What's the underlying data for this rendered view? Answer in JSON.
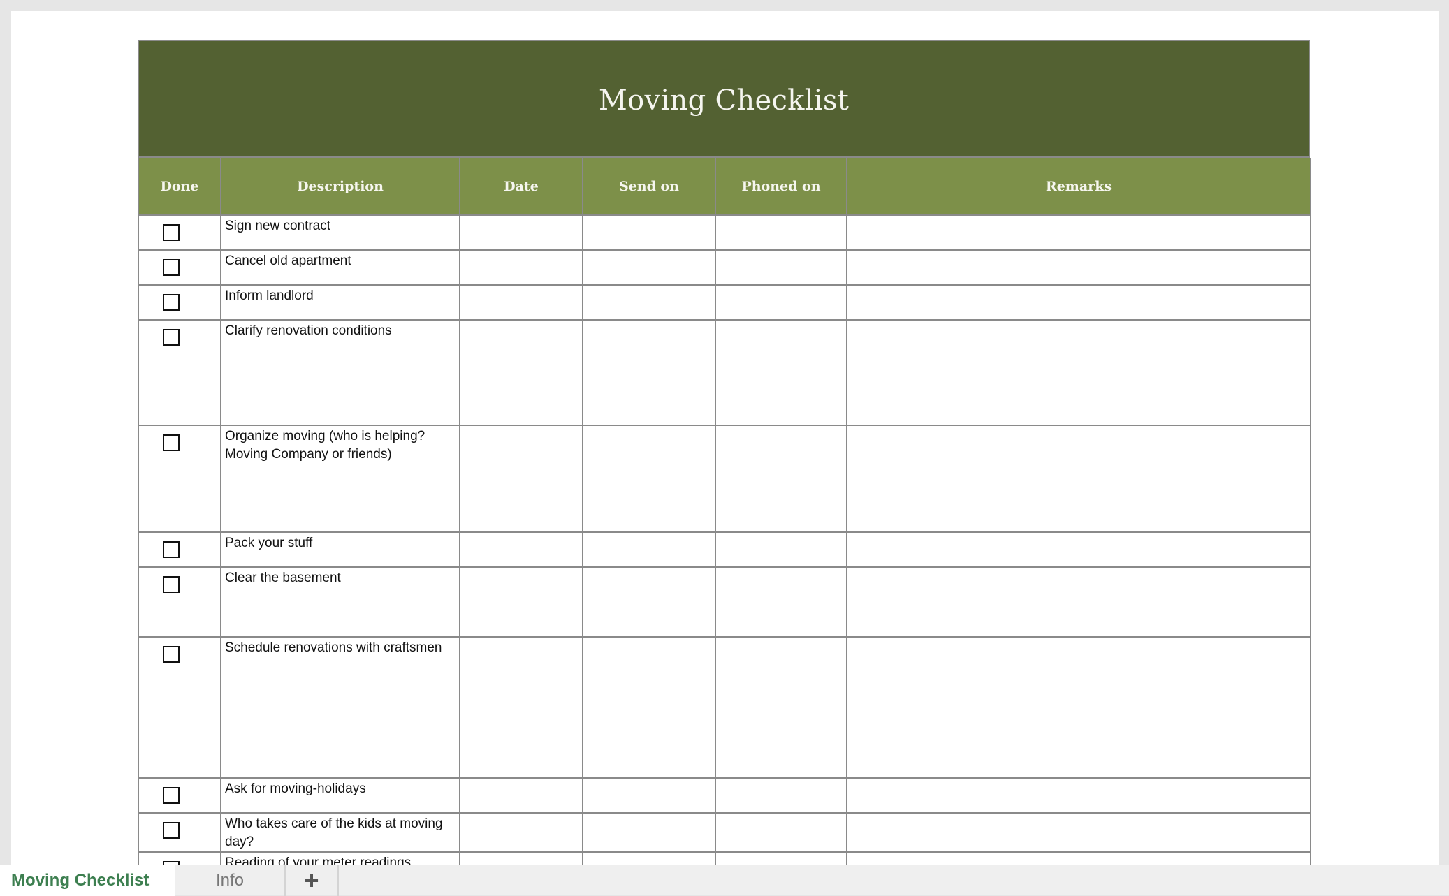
{
  "sheet": {
    "title": "Moving Checklist",
    "columns": [
      "Done",
      "Description",
      "Date",
      "Send on",
      "Phoned on",
      "Remarks"
    ],
    "rows": [
      {
        "done": false,
        "description": "Sign new contract",
        "date": "",
        "send_on": "",
        "phoned_on": "",
        "remarks": ""
      },
      {
        "done": false,
        "description": "Cancel old apartment",
        "date": "",
        "send_on": "",
        "phoned_on": "",
        "remarks": ""
      },
      {
        "done": false,
        "description": "Inform landlord",
        "date": "",
        "send_on": "",
        "phoned_on": "",
        "remarks": ""
      },
      {
        "done": false,
        "description": "Clarify renovation conditions",
        "date": "",
        "send_on": "",
        "phoned_on": "",
        "remarks": ""
      },
      {
        "done": false,
        "description": "Organize moving (who is helping? Moving Company or friends)",
        "date": "",
        "send_on": "",
        "phoned_on": "",
        "remarks": ""
      },
      {
        "done": false,
        "description": "Pack your stuff",
        "date": "",
        "send_on": "",
        "phoned_on": "",
        "remarks": ""
      },
      {
        "done": false,
        "description": "Clear the basement",
        "date": "",
        "send_on": "",
        "phoned_on": "",
        "remarks": ""
      },
      {
        "done": false,
        "description": "Schedule renovations with craftsmen",
        "date": "",
        "send_on": "",
        "phoned_on": "",
        "remarks": ""
      },
      {
        "done": false,
        "description": "Ask for moving-holidays",
        "date": "",
        "send_on": "",
        "phoned_on": "",
        "remarks": ""
      },
      {
        "done": false,
        "description": "Who takes care of the kids at moving day?",
        "date": "",
        "send_on": "",
        "phoned_on": "",
        "remarks": ""
      },
      {
        "done": false,
        "description": "Reading of your meter readings",
        "date": "",
        "send_on": "",
        "phoned_on": "",
        "remarks": ""
      }
    ]
  },
  "tabs": [
    {
      "label": "Moving Checklist",
      "active": true
    },
    {
      "label": "Info",
      "active": false
    }
  ],
  "add_tab": {
    "icon": "plus-icon",
    "label": "+"
  },
  "colors": {
    "title_band": "#536132",
    "header_band": "#7d9049",
    "active_tab_text": "#3d7f50"
  }
}
